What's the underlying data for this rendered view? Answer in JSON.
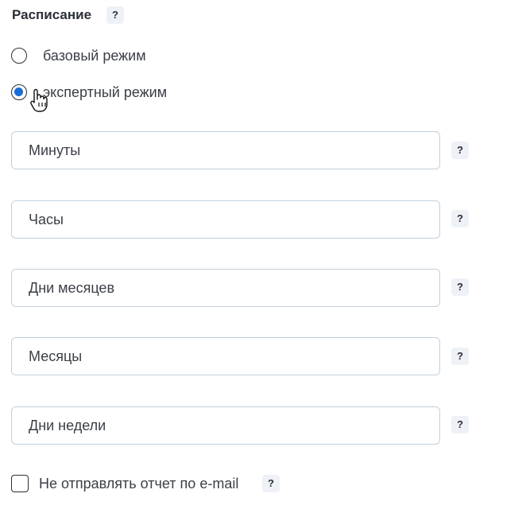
{
  "schedule": {
    "title": "Расписание",
    "help": "?"
  },
  "mode": {
    "options": [
      {
        "label": "базовый режим",
        "checked": false
      },
      {
        "label": "экспертный режим",
        "checked": true
      }
    ]
  },
  "fields": [
    {
      "placeholder": "Минуты",
      "help": "?"
    },
    {
      "placeholder": "Часы",
      "help": "?"
    },
    {
      "placeholder": "Дни месяцев",
      "help": "?"
    },
    {
      "placeholder": "Месяцы",
      "help": "?"
    },
    {
      "placeholder": "Дни недели",
      "help": "?"
    }
  ],
  "email_opt_out": {
    "label": "Не отправлять отчет по e-mail",
    "checked": false,
    "help": "?"
  },
  "colors": {
    "accent": "#1a6fd6",
    "border": "#c2d0dd",
    "help_bg": "#eef2f7"
  }
}
